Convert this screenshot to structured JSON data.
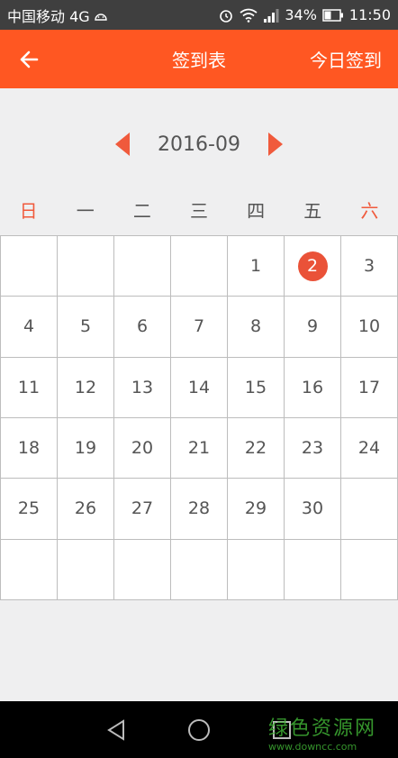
{
  "status_bar": {
    "carrier": "中国移动 4G",
    "battery": "34%",
    "time": "11:50"
  },
  "app_bar": {
    "title": "签到表",
    "checkin_label": "今日签到"
  },
  "calendar": {
    "month": "2016-09",
    "weekdays": [
      "日",
      "一",
      "二",
      "三",
      "四",
      "五",
      "六"
    ],
    "cells": [
      "",
      "",
      "",
      "",
      "1",
      "2",
      "3",
      "4",
      "5",
      "6",
      "7",
      "8",
      "9",
      "10",
      "11",
      "12",
      "13",
      "14",
      "15",
      "16",
      "17",
      "18",
      "19",
      "20",
      "21",
      "22",
      "23",
      "24",
      "25",
      "26",
      "27",
      "28",
      "29",
      "30",
      "",
      "",
      "",
      "",
      "",
      "",
      "",
      ""
    ],
    "highlighted_day": "2",
    "highlight_color": "#ea5238"
  },
  "theme": {
    "accent": "#ff5722"
  },
  "watermark": {
    "text": "绿色资源网",
    "url": "www.downcc.com"
  }
}
